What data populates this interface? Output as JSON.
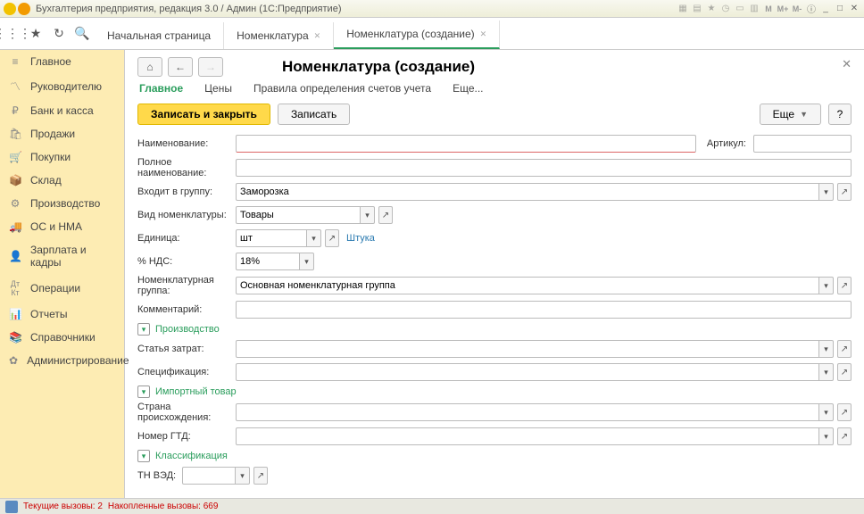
{
  "titlebar": {
    "title": "Бухгалтерия предприятия, редакция 3.0 / Админ  (1С:Предприятие)"
  },
  "tabs": {
    "t0": "Начальная страница",
    "t1": "Номенклатура",
    "t2": "Номенклатура (создание)"
  },
  "sidebar": {
    "items": [
      {
        "icon": "≡",
        "label": "Главное"
      },
      {
        "icon": "〽",
        "label": "Руководителю"
      },
      {
        "icon": "₽",
        "label": "Банк и касса"
      },
      {
        "icon": "🛍",
        "label": "Продажи"
      },
      {
        "icon": "🛒",
        "label": "Покупки"
      },
      {
        "icon": "📦",
        "label": "Склад"
      },
      {
        "icon": "⚙",
        "label": "Производство"
      },
      {
        "icon": "🚚",
        "label": "ОС и НМА"
      },
      {
        "icon": "👤",
        "label": "Зарплата и кадры"
      },
      {
        "icon": "ᴰᴷ",
        "label": "Операции"
      },
      {
        "icon": "📊",
        "label": "Отчеты"
      },
      {
        "icon": "📚",
        "label": "Справочники"
      },
      {
        "icon": "✿",
        "label": "Администрирование"
      }
    ]
  },
  "content": {
    "title": "Номенклатура (создание)",
    "subtabs": {
      "main": "Главное",
      "prices": "Цены",
      "rules": "Правила определения счетов учета",
      "more": "Еще..."
    },
    "actions": {
      "save_close": "Записать и закрыть",
      "save": "Записать",
      "more": "Еще",
      "help": "?"
    },
    "labels": {
      "name": "Наименование:",
      "article": "Артикул:",
      "fullname": "Полное наименование:",
      "group": "Входит в группу:",
      "kind": "Вид номенклатуры:",
      "unit": "Единица:",
      "unit_link": "Штука",
      "vat": "% НДС:",
      "nomgroup": "Номенклатурная группа:",
      "comment": "Комментарий:",
      "prod": "Производство",
      "cost_item": "Статья затрат:",
      "spec": "Спецификация:",
      "import": "Импортный товар",
      "origin": "Страна происхождения:",
      "gtd": "Номер ГТД:",
      "class": "Классификация",
      "tnved": "ТН ВЭД:"
    },
    "values": {
      "group": "Заморозка",
      "kind": "Товары",
      "unit": "шт",
      "vat": "18%",
      "nomgroup": "Основная номенклатурная группа"
    }
  },
  "status": {
    "calls": "Текущие вызовы: 2",
    "acc": "Накопленные вызовы: 669"
  }
}
